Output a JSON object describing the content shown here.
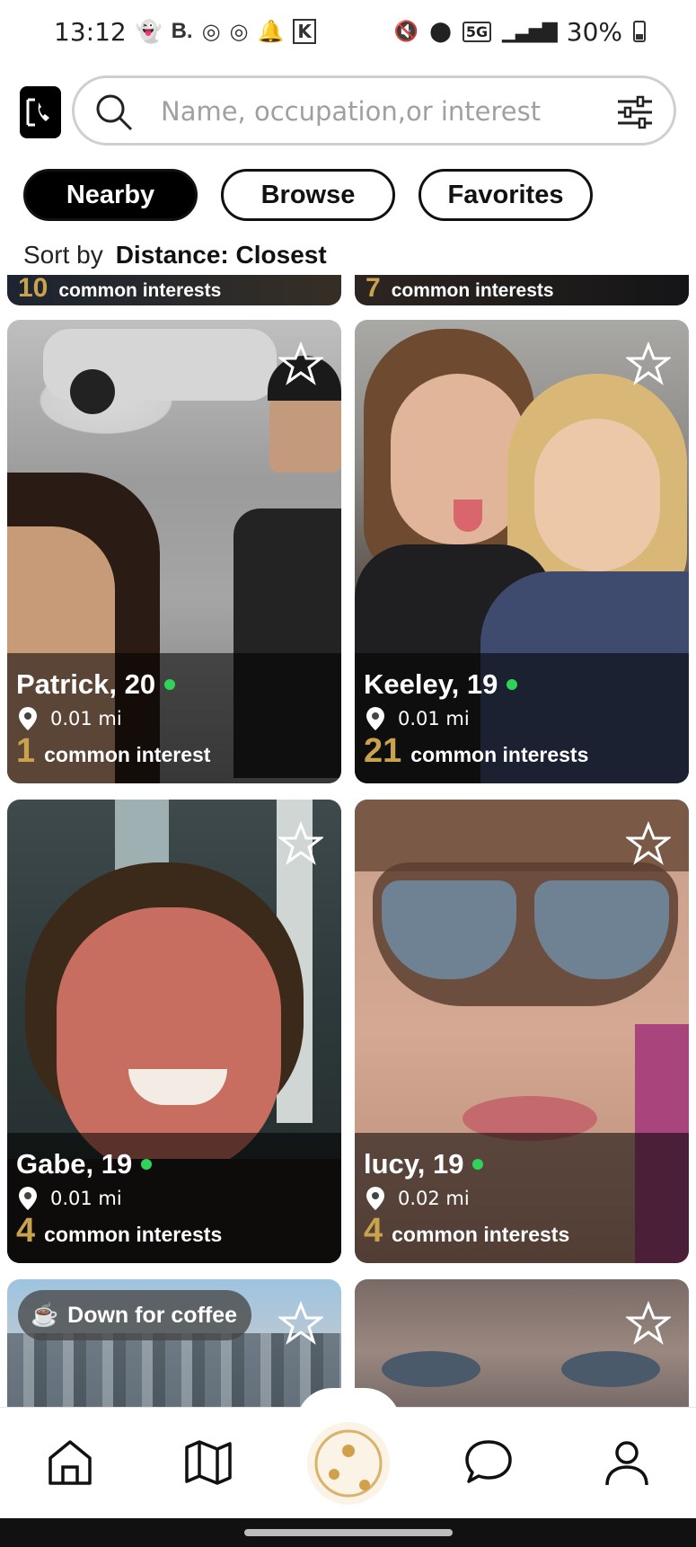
{
  "status_bar": {
    "time": "13:12",
    "battery": "30%",
    "network": "5G"
  },
  "search": {
    "placeholder": "Name, occupation,or interest",
    "value": ""
  },
  "tabs": [
    {
      "label": "Nearby",
      "active": true
    },
    {
      "label": "Browse",
      "active": false
    },
    {
      "label": "Favorites",
      "active": false
    }
  ],
  "sort": {
    "label": "Sort by",
    "value": "Distance: Closest"
  },
  "partial_cards": [
    {
      "count": "10",
      "label": "common interests"
    },
    {
      "count": "7",
      "label": "common interests"
    }
  ],
  "profiles": [
    {
      "name": "Patrick, 20",
      "online": true,
      "distance": "0.01 mi",
      "common_count": "1",
      "common_label": "common interest"
    },
    {
      "name": "Keeley, 19",
      "online": true,
      "distance": "0.01 mi",
      "common_count": "21",
      "common_label": "common interests"
    },
    {
      "name": "Gabe, 19",
      "online": true,
      "distance": "0.01 mi",
      "common_count": "4",
      "common_label": "common interests"
    },
    {
      "name": "lucy, 19",
      "online": true,
      "distance": "0.02 mi",
      "common_count": "4",
      "common_label": "common interests"
    }
  ],
  "bottom_cards": [
    {
      "status": "Down for coffee",
      "status_icon": "coffee-icon"
    },
    {
      "status": ""
    }
  ],
  "nav": [
    "home-icon",
    "map-icon",
    "connect-icon",
    "chat-icon",
    "profile-icon"
  ],
  "colors": {
    "accent_gold": "#c9a24d",
    "online_green": "#2fd35a",
    "primary": "#000000"
  }
}
